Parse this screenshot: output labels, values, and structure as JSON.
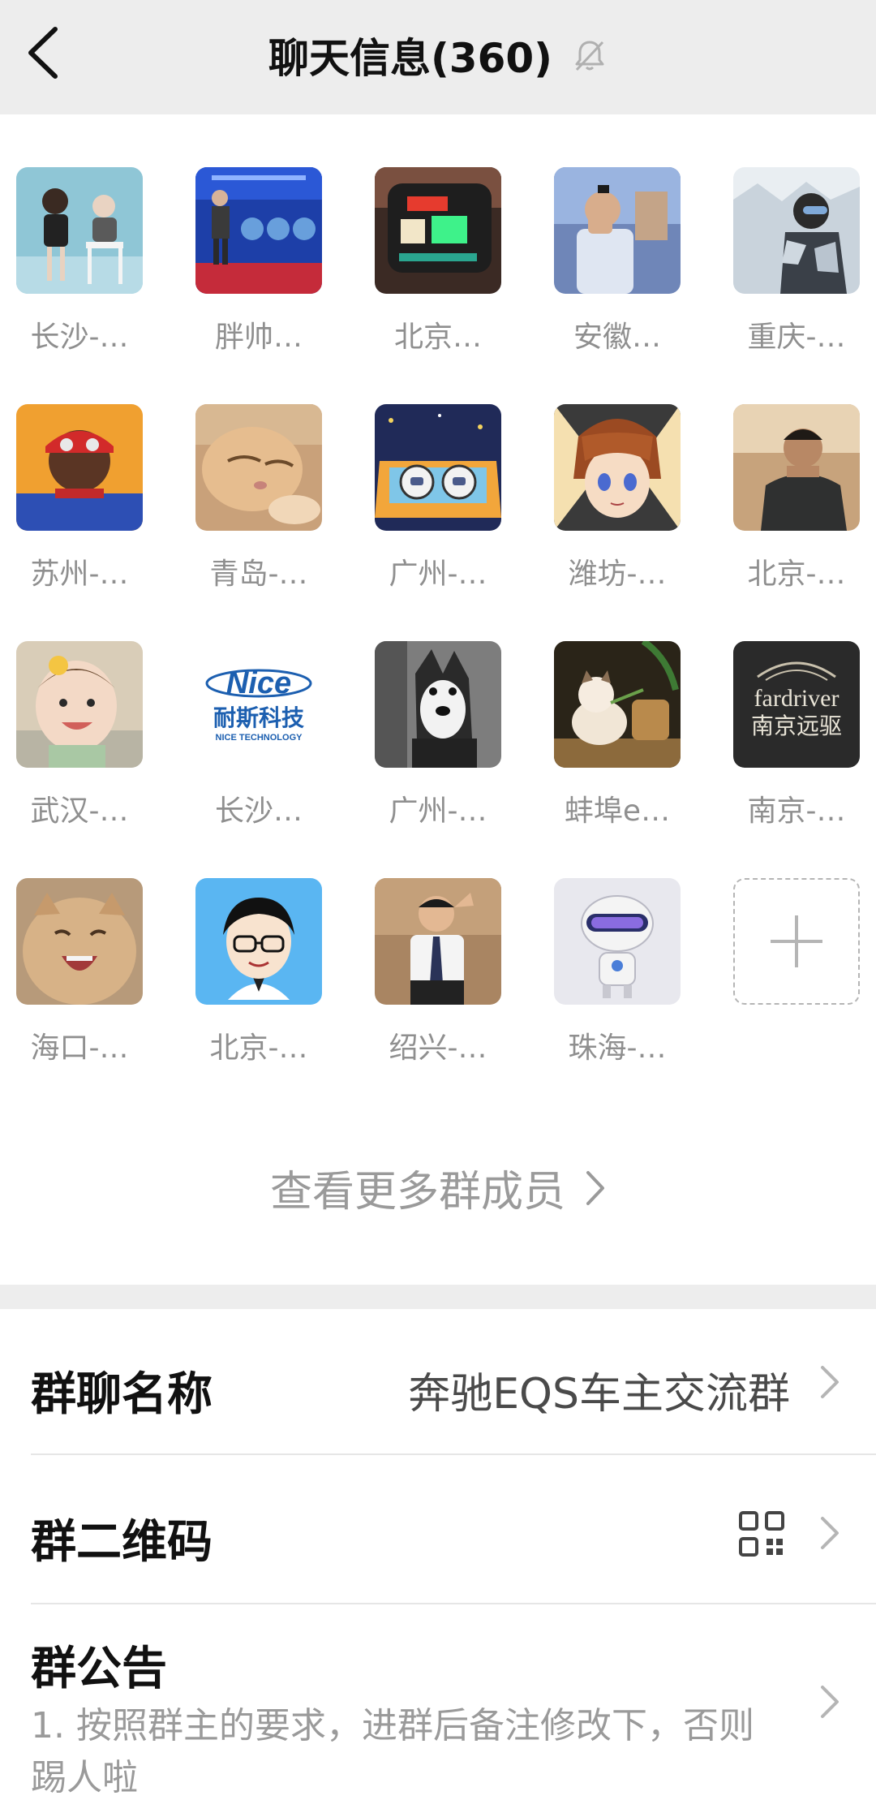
{
  "header": {
    "title": "聊天信息(360)"
  },
  "members": [
    {
      "name": "长沙-…",
      "avatar": "photo-kids"
    },
    {
      "name": "胖帅…",
      "avatar": "photo-stage-speaker"
    },
    {
      "name": "北京…",
      "avatar": "photo-neon-device"
    },
    {
      "name": "安徽…",
      "avatar": "photo-man-glasses"
    },
    {
      "name": "重庆-…",
      "avatar": "photo-snowboarder"
    },
    {
      "name": "苏州-…",
      "avatar": "photo-spiderman"
    },
    {
      "name": "青岛-…",
      "avatar": "photo-cat-sleeping"
    },
    {
      "name": "广州-…",
      "avatar": "illustration-astronauts-car"
    },
    {
      "name": "潍坊-…",
      "avatar": "illustration-anime-boy"
    },
    {
      "name": "北京-…",
      "avatar": "photo-man-meeting"
    },
    {
      "name": "武汉-…",
      "avatar": "photo-baby"
    },
    {
      "name": "长沙…",
      "avatar": "logo-nice-technology"
    },
    {
      "name": "广州-…",
      "avatar": "photo-husky"
    },
    {
      "name": "蚌埠e…",
      "avatar": "photo-kitten-basket"
    },
    {
      "name": "南京-…",
      "avatar": "logo-fardriver"
    },
    {
      "name": "海口-…",
      "avatar": "photo-cat-yawning"
    },
    {
      "name": "北京-…",
      "avatar": "cartoon-man-glasses"
    },
    {
      "name": "绍兴-…",
      "avatar": "photo-boy-salute"
    },
    {
      "name": "珠海-…",
      "avatar": "illustration-robot"
    }
  ],
  "logos": {
    "nice_brand": "Nice",
    "nice_cn": "耐斯科技",
    "nice_en": "NICE TECHNOLOGY",
    "fardriver_brand": "fardriver",
    "fardriver_cn": "南京远驱"
  },
  "more_members_label": "查看更多群成员",
  "settings": {
    "group_name_label": "群聊名称",
    "group_name_value": "奔驰EQS车主交流群",
    "qr_label": "群二维码",
    "notice_label": "群公告",
    "notice_text": "1. 按照群主的要求，进群后备注修改下，否则踢人啦"
  },
  "colors": {
    "page_bg": "#ededed",
    "card_bg": "#ffffff",
    "muted_text": "#8f8f8f"
  }
}
